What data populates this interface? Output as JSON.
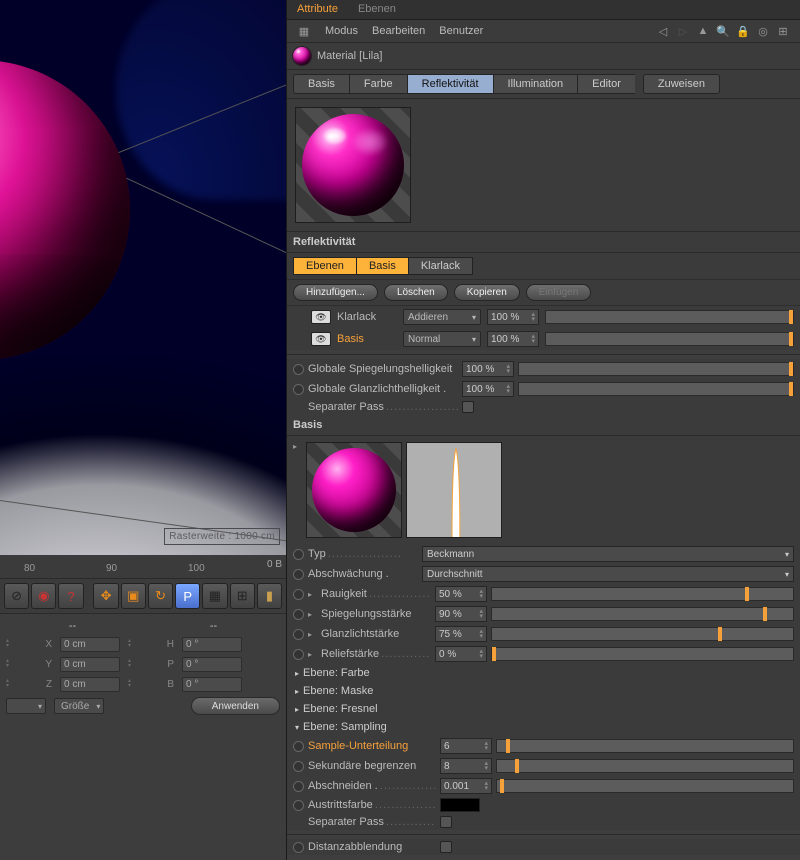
{
  "viewport": {
    "rasterweite": "Rasterweite : 1000 cm"
  },
  "timeline": {
    "ticks": [
      "80",
      "90",
      "100"
    ],
    "frame": "0 B",
    "coords": {
      "x": {
        "lbl": "X",
        "val": "0 cm"
      },
      "y": {
        "lbl": "Y",
        "val": "0 cm"
      },
      "z": {
        "lbl": "Z",
        "val": "0 cm"
      },
      "h": {
        "lbl": "H",
        "val": "0 °"
      },
      "p": {
        "lbl": "P",
        "val": "0 °"
      },
      "b": {
        "lbl": "B",
        "val": "0 °"
      }
    },
    "size_select": "Größe",
    "apply": "Anwenden"
  },
  "attr": {
    "top_tabs": {
      "attribute": "Attribute",
      "ebenen": "Ebenen"
    },
    "menu": {
      "mode": "Modus",
      "edit": "Bearbeiten",
      "user": "Benutzer"
    },
    "material_name": "Material [Lila]",
    "channels": {
      "basic": "Basis",
      "color": "Farbe",
      "refl": "Reflektivität",
      "illum": "Illumination",
      "editor": "Editor",
      "assign": "Zuweisen"
    },
    "refl_header": "Reflektivität",
    "subtabs": {
      "layers": "Ebenen",
      "basis": "Basis",
      "clear": "Klarlack"
    },
    "buttons": {
      "add": "Hinzufügen...",
      "del": "Löschen",
      "copy": "Kopieren",
      "paste": "Einfügen"
    },
    "layers": {
      "clear": {
        "name": "Klarlack",
        "blend": "Addieren",
        "val": "100 %"
      },
      "basis": {
        "name": "Basis",
        "blend": "Normal",
        "val": "100 %"
      }
    },
    "global": {
      "mirror": {
        "label": "Globale Spiegelungshelligkeit",
        "val": "100 %"
      },
      "glanz": {
        "label": "Globale Glanzlichthelligkeit .",
        "val": "100 %"
      },
      "seppass": "Separater Pass"
    },
    "basis_header": "Basis",
    "typ": {
      "label": "Typ",
      "val": "Beckmann"
    },
    "absch": {
      "label": "Abschwächung .",
      "val": "Durchschnitt"
    },
    "rough": {
      "label": "Rauigkeit",
      "val": "50 %",
      "pct": 50
    },
    "specstr": {
      "label": "Spiegelungsstärke",
      "val": "90 %",
      "pct": 90
    },
    "glanzstr": {
      "label": "Glanzlichtstärke",
      "val": "75 %",
      "pct": 75
    },
    "relief": {
      "label": "Reliefstärke",
      "val": "0 %",
      "pct": 0
    },
    "exp": {
      "farbe": "Ebene: Farbe",
      "maske": "Ebene: Maske",
      "fresnel": "Ebene: Fresnel",
      "sampling": "Ebene: Sampling"
    },
    "samp": {
      "subdiv": {
        "label": "Sample-Unterteilung",
        "val": "6",
        "pct": 1
      },
      "seclimit": {
        "label": "Sekundäre begrenzen",
        "val": "8",
        "pct": 1
      },
      "cutoff": {
        "label": "Abschneiden .",
        "val": "0.001",
        "pct": 1
      },
      "exit": {
        "label": "Austrittsfarbe"
      },
      "seppass": "Separater Pass",
      "dist": "Distanzabblendung"
    }
  }
}
